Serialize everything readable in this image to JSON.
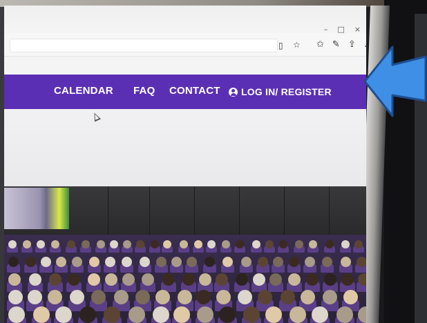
{
  "browser": {
    "window_controls": [
      "–",
      "□",
      "×"
    ],
    "toolbar_icons": {
      "reader": "reader-icon",
      "favorite": "star-icon",
      "favorites": "favorites-icon",
      "pen": "pen-icon",
      "share": "share-icon",
      "more": "more-icon"
    }
  },
  "nav": {
    "background": "#5b2fb3",
    "items": [
      {
        "label": "CALENDAR"
      },
      {
        "label": "FAQ"
      },
      {
        "label": "CONTACT"
      },
      {
        "label": "LOG IN/ REGISTER",
        "icon": "user-icon"
      }
    ]
  },
  "overlay": {
    "arrow_color": "#3f8fe6",
    "arrow_icon": "arrow-icon"
  }
}
